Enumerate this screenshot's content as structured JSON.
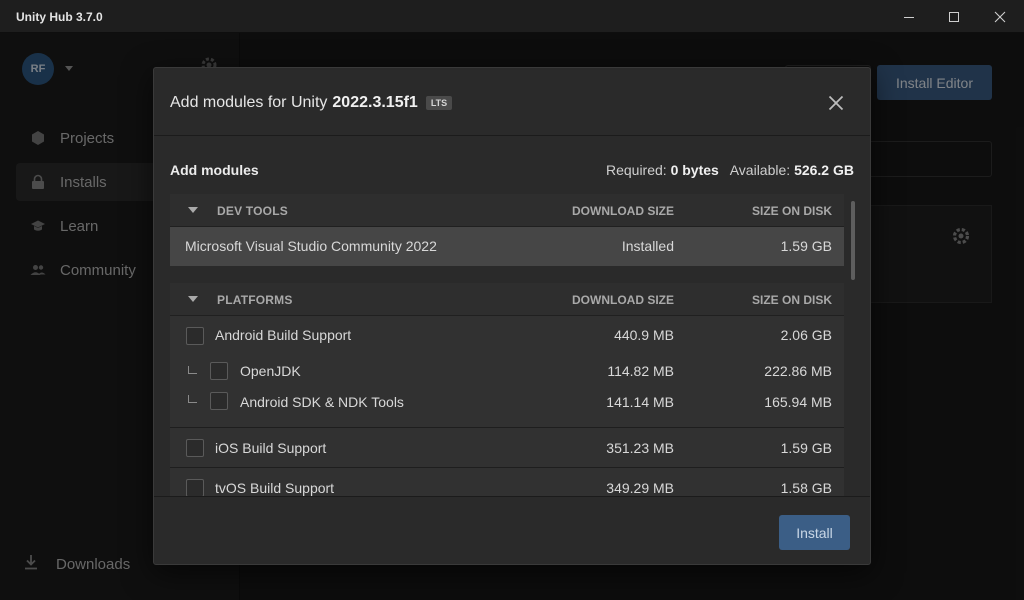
{
  "window": {
    "title": "Unity Hub 3.7.0"
  },
  "user": {
    "initials": "RF"
  },
  "sidebar": {
    "items": [
      {
        "label": "Projects",
        "icon": "cube-icon"
      },
      {
        "label": "Installs",
        "icon": "lock-icon"
      },
      {
        "label": "Learn",
        "icon": "graduation-cap-icon"
      },
      {
        "label": "Community",
        "icon": "people-icon"
      }
    ],
    "downloads_label": "Downloads"
  },
  "background": {
    "install_editor_label": "Install Editor"
  },
  "dialog": {
    "title_prefix": "Add modules for Unity",
    "version": "2022.3.15f1",
    "badge": "LTS",
    "section_title": "Add modules",
    "required_label": "Required:",
    "required_value": "0 bytes",
    "available_label": "Available:",
    "available_value": "526.2 GB",
    "install_label": "Install"
  },
  "groups": {
    "dev_tools": {
      "name": "DEV TOOLS",
      "col_download": "DOWNLOAD SIZE",
      "col_disk": "SIZE ON DISK",
      "rows": [
        {
          "label": "Microsoft Visual Studio Community 2022",
          "download": "Installed",
          "disk": "1.59 GB"
        }
      ]
    },
    "platforms": {
      "name": "PLATFORMS",
      "col_download": "DOWNLOAD SIZE",
      "col_disk": "SIZE ON DISK",
      "rows": [
        {
          "label": "Android Build Support",
          "download": "440.9 MB",
          "disk": "2.06 GB",
          "checked": false
        },
        {
          "label": "OpenJDK",
          "download": "114.82 MB",
          "disk": "222.86 MB",
          "checked": false
        },
        {
          "label": "Android SDK & NDK Tools",
          "download": "141.14 MB",
          "disk": "165.94 MB",
          "checked": false
        },
        {
          "label": "iOS Build Support",
          "download": "351.23 MB",
          "disk": "1.59 GB",
          "checked": false
        },
        {
          "label": "tvOS Build Support",
          "download": "349.29 MB",
          "disk": "1.58 GB",
          "checked": false
        }
      ]
    }
  }
}
